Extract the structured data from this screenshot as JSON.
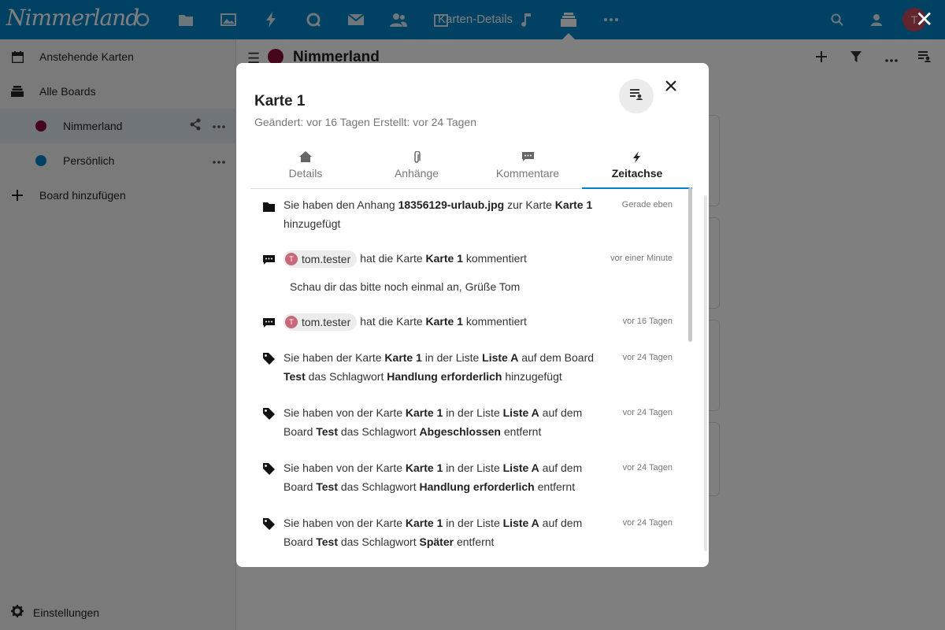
{
  "header": {
    "logo": "Nimmerland",
    "app_title": "Karten-Details",
    "avatar_letter": "T",
    "apps": [
      "dashboard-icon",
      "files-icon",
      "photos-icon",
      "activity-icon",
      "talk-icon",
      "mail-icon",
      "contacts-icon",
      "calendar-icon",
      "music-icon",
      "deck-icon",
      "more-icon"
    ],
    "close_glyph": "✕"
  },
  "sidebar": {
    "items": [
      {
        "label": "Anstehende Karten",
        "icon": "calendar-icon"
      },
      {
        "label": "Alle Boards",
        "icon": "archive-icon"
      },
      {
        "label": "Nimmerland",
        "color": "#8b0a3a"
      },
      {
        "label": "Persönlich",
        "color": "#0082c9"
      },
      {
        "label": "Board hinzufügen",
        "icon": "plus-icon"
      }
    ],
    "settings_label": "Einstellungen"
  },
  "board": {
    "title": "Nimmerland",
    "color": "#8b0a3a"
  },
  "modal": {
    "card_title": "Karte 1",
    "meta": "Geändert: vor 16 Tagen Erstellt: vor 24 Tagen",
    "tabs": [
      {
        "label": "Details",
        "icon": "home-icon"
      },
      {
        "label": "Anhänge",
        "icon": "paperclip-icon"
      },
      {
        "label": "Kommentare",
        "icon": "comment-icon"
      },
      {
        "label": "Zeitachse",
        "icon": "lightning-icon",
        "active": true
      }
    ],
    "timeline": [
      {
        "icon": "folder-icon",
        "time": "Gerade eben",
        "parts": [
          "Sie haben den Anhang ",
          "18356129-urlaub.jpg",
          " zur Karte ",
          "Karte 1",
          " hinzugefügt"
        ]
      },
      {
        "icon": "comment-icon",
        "time": "vor einer Minute",
        "user": "tom.tester",
        "user_initial": "T",
        "parts": [
          "hat die Karte ",
          "Karte 1",
          " kommentiert"
        ],
        "comment": "Schau dir das bitte noch einmal an, Grüße Tom"
      },
      {
        "icon": "comment-icon",
        "time": "vor 16 Tagen",
        "user": "tom.tester",
        "user_initial": "T",
        "parts": [
          "hat die Karte ",
          "Karte 1",
          " kommentiert"
        ]
      },
      {
        "icon": "tag-icon",
        "time": "vor 24 Tagen",
        "parts": [
          "Sie haben der Karte ",
          "Karte 1",
          " in der Liste ",
          "Liste A",
          " auf dem Board ",
          "Test",
          " das Schlagwort ",
          "Handlung erforderlich",
          " hinzugefügt"
        ]
      },
      {
        "icon": "tag-icon",
        "time": "vor 24 Tagen",
        "parts": [
          "Sie haben von der Karte ",
          "Karte 1",
          " in der Liste ",
          "Liste A",
          " auf dem Board ",
          "Test",
          " das Schlagwort ",
          "Abgeschlossen",
          " entfernt"
        ]
      },
      {
        "icon": "tag-icon",
        "time": "vor 24 Tagen",
        "parts": [
          "Sie haben von der Karte ",
          "Karte 1",
          " in der Liste ",
          "Liste A",
          " auf dem Board ",
          "Test",
          " das Schlagwort ",
          "Handlung erforderlich",
          " entfernt"
        ]
      },
      {
        "icon": "tag-icon",
        "time": "vor 24 Tagen",
        "parts": [
          "Sie haben von der Karte ",
          "Karte 1",
          " in der Liste ",
          "Liste A",
          " auf dem Board ",
          "Test",
          " das Schlagwort ",
          "Später",
          " entfernt"
        ]
      }
    ]
  }
}
